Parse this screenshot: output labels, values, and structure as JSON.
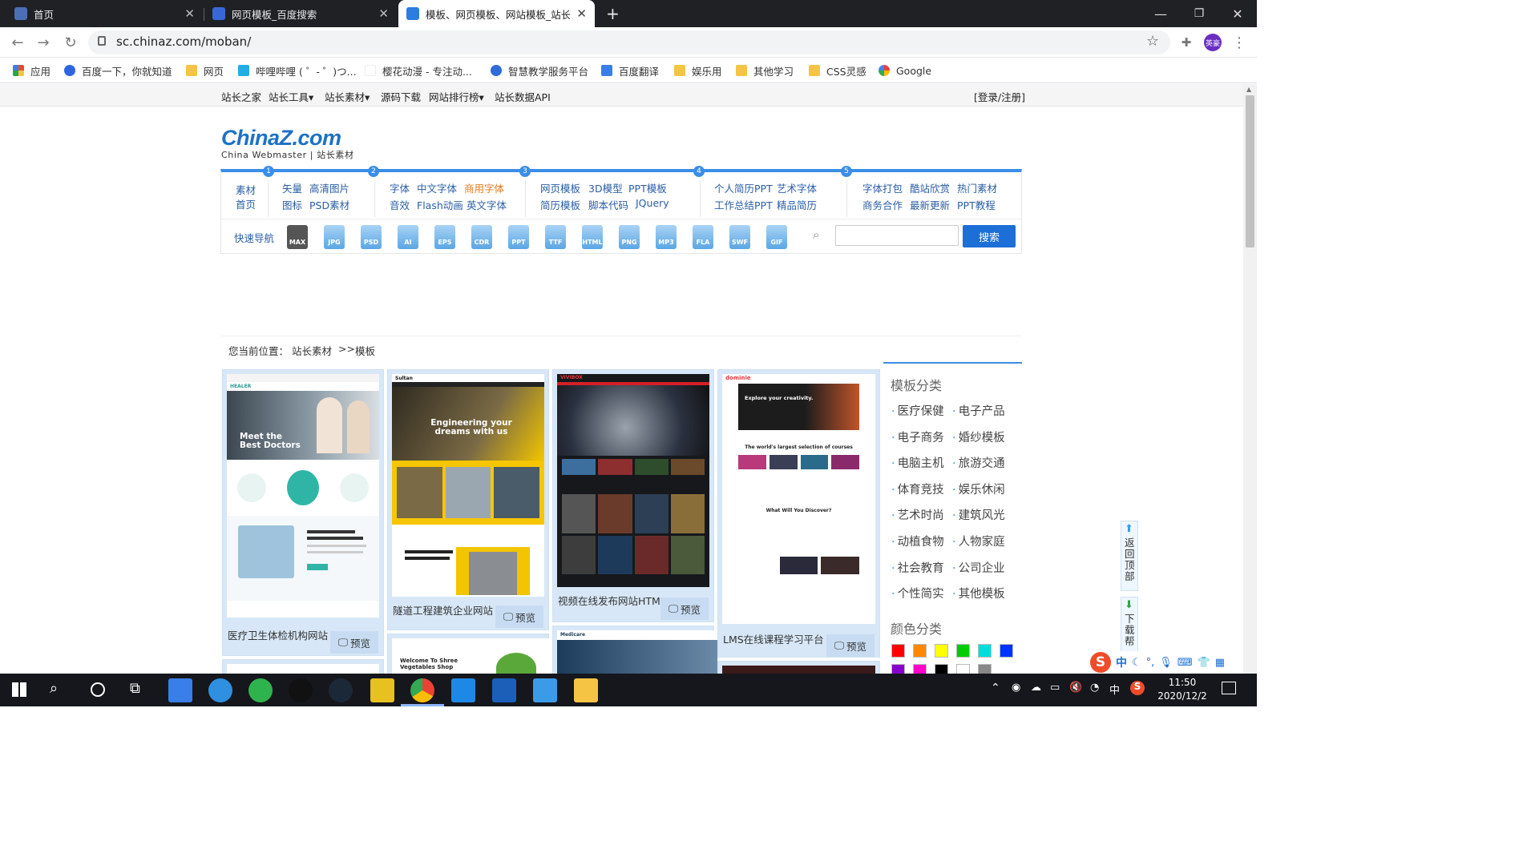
{
  "browser": {
    "tabs": [
      {
        "title": "首页",
        "favicon_color": "#4a6fb6"
      },
      {
        "title": "网页模板_百度搜索",
        "favicon_color": "#3867d6"
      },
      {
        "title": "模板、网页模板、网站模板_站长",
        "favicon_color": "#2b7de0"
      }
    ],
    "new_tab": "+",
    "window_buttons": {
      "minimize": "—",
      "restore": "❐",
      "close": "✕"
    },
    "url": "sc.chinaz.com/moban/",
    "profile_label": "英豪",
    "bookmarks": [
      {
        "label": "应用",
        "color": "#e0502b"
      },
      {
        "label": "百度一下，你就知道",
        "color": "#2f64e0"
      },
      {
        "label": "网页",
        "color": "#f5c445"
      },
      {
        "label": "哔哩哔哩 ( ゜- ゜)つ...",
        "color": "#23ade5"
      },
      {
        "label": "樱花动漫 - 专注动...",
        "color": "#ffffff"
      },
      {
        "label": "智慧教学服务平台",
        "color": "#2e6bd8"
      },
      {
        "label": "百度翻译",
        "color": "#3a7ee8"
      },
      {
        "label": "娱乐用",
        "color": "#f5c445"
      },
      {
        "label": "其他学习",
        "color": "#f5c445"
      },
      {
        "label": "CSS灵感",
        "color": "#f5c445"
      },
      {
        "label": "Google",
        "color": "#4285f4"
      }
    ]
  },
  "site": {
    "topnav": {
      "items": [
        "站长之家",
        "站长工具▾",
        "站长素材▾",
        "源码下载",
        "网站排行榜▾",
        "站长数据API"
      ],
      "login": "[登录/注册]"
    },
    "logo": {
      "main_a": "China",
      "main_z": "Z",
      "main_b": ".com",
      "sub": "China Webmaster | 站长素材"
    },
    "category_box": {
      "home_line1": "素材",
      "home_line2": "首页",
      "numbers": [
        "1",
        "2",
        "3",
        "4",
        "5"
      ],
      "group1": [
        "矢量",
        "高清图片",
        "图标",
        "PSD素材"
      ],
      "group2": [
        "字体",
        "中文字体",
        "商用字体",
        "音效",
        "Flash动画",
        "英文字体"
      ],
      "group3": [
        "网页模板",
        "3D模型",
        "PPT模板",
        "简历模板",
        "脚本代码",
        "JQuery"
      ],
      "group4": [
        "个人简历PPT",
        "艺术字体",
        "工作总结PPT",
        "精品简历"
      ],
      "group5": [
        "字体打包",
        "酷站欣赏",
        "热门素材",
        "商务合作",
        "最新更新",
        "PPT教程"
      ],
      "quick_nav": "快速导航",
      "formats": [
        "MAX",
        "JPG",
        "PSD",
        "AI",
        "EPS",
        "CDR",
        "PPT",
        "TTF",
        "HTML",
        "PNG",
        "MP3",
        "FLA",
        "SWF",
        "GIF"
      ],
      "search_button": "搜索"
    },
    "breadcrumb": {
      "prefix": "您当前位置：",
      "level1": "站长素材",
      "sep": ">>",
      "level2": "模板"
    },
    "cards": [
      {
        "title": "医疗卫生体检机构网站",
        "preview": "预览"
      },
      {
        "title": "隧道工程建筑企业网站",
        "preview": "预览"
      },
      {
        "title": "视频在线发布网站HTML",
        "preview": "预览"
      },
      {
        "title": "LMS在线课程学习平台",
        "preview": "预览"
      }
    ],
    "thumb_text": {
      "medical": "Meet the Best Doctors",
      "engineering": "Engineering your dreams with us",
      "lms_brand": "dominie",
      "lms_head": "Explore your creativity.",
      "lms_mid": "The world's largest selection of courses",
      "lms_discover": "What Will You Discover?",
      "veg": "Welcome To Shree Vegetables Shop",
      "medicalr": "Medicare",
      "medical_brand": "HEALER",
      "eng_brand": "Sultan",
      "video_brand": "VIVIBOX"
    },
    "sidebar": {
      "title": "模板分类",
      "categories": [
        "医疗保健",
        "电子产品",
        "电子商务",
        "婚纱模板",
        "电脑主机",
        "旅游交通",
        "体育竞技",
        "娱乐休闲",
        "艺术时尚",
        "建筑风光",
        "动植食物",
        "人物家庭",
        "社会教育",
        "公司企业",
        "个性简实",
        "其他模板"
      ],
      "color_title": "颜色分类",
      "colors": [
        "#ff0000",
        "#ff8800",
        "#ffff00",
        "#00cc00",
        "#00dddd",
        "#0033ff",
        "#8800cc",
        "#ff00cc",
        "#000000",
        "#ffffff",
        "#888888"
      ]
    },
    "float": {
      "back_top": "返回顶部",
      "download_help": "下载帮"
    }
  },
  "taskbar": {
    "time": "11:50",
    "date": "2020/12/2",
    "ime": "中"
  }
}
